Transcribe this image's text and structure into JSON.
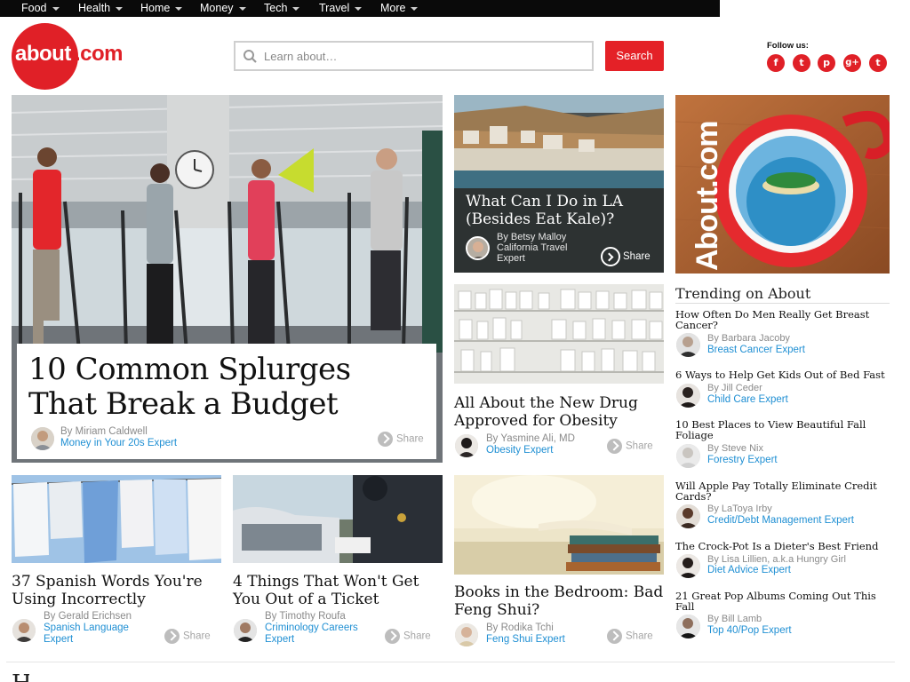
{
  "nav": [
    "Food",
    "Health",
    "Home",
    "Money",
    "Tech",
    "Travel",
    "More"
  ],
  "logo": {
    "about": "about",
    "com": ".com"
  },
  "search": {
    "placeholder": "Learn about…",
    "button": "Search"
  },
  "follow": {
    "label": "Follow us:",
    "icons": [
      "facebook-icon",
      "twitter-icon",
      "pinterest-icon",
      "googleplus-icon",
      "tumblr-icon"
    ]
  },
  "colors": {
    "brand_red": "#e02027",
    "link_blue": "#1f8fd3",
    "nav_bg": "#0a0a0a"
  },
  "hero": {
    "title": "10 Common Splurges That Break a Budget",
    "author": "By Miriam Caldwell",
    "expert": "Money in Your 20s Expert",
    "share": "Share"
  },
  "la": {
    "title": "What Can I Do in LA (Besides Eat Kale)?",
    "author": "By Betsy Malloy",
    "expert": "California Travel Expert",
    "share": "Share"
  },
  "promo": {
    "brand_text": "About.com"
  },
  "drug": {
    "title": "All About the New Drug Approved for Obesity",
    "author": "By Yasmine Ali, MD",
    "expert": "Obesity Expert",
    "share": "Share"
  },
  "spanish": {
    "title": "37 Spanish Words You're Using Incorrectly",
    "author": "By Gerald Erichsen",
    "expert": "Spanish Language Expert",
    "share": "Share"
  },
  "ticket": {
    "title": "4 Things That Won't Get You Out of a Ticket",
    "author": "By Timothy Roufa",
    "expert": "Criminology Careers Expert",
    "share": "Share"
  },
  "books": {
    "title": "Books in the Bedroom: Bad Feng Shui?",
    "author": "By Rodika Tchi",
    "expert": "Feng Shui Expert",
    "share": "Share"
  },
  "trending": {
    "heading": "Trending on About",
    "items": [
      {
        "title": "How Often Do Men Really Get Breast Cancer?",
        "author": "By Barbara Jacoby",
        "expert": "Breast Cancer Expert"
      },
      {
        "title": "6 Ways to Help Get Kids Out of Bed Fast",
        "author": "By Jill Ceder",
        "expert": "Child Care Expert"
      },
      {
        "title": "10 Best Places to View Beautiful Fall Foliage",
        "author": "By Steve Nix",
        "expert": "Forestry Expert"
      },
      {
        "title": "Will Apple Pay Totally Eliminate Credit Cards?",
        "author": "By LaToya Irby",
        "expert": "Credit/Debt Management Expert"
      },
      {
        "title": "The Crock-Pot Is a Dieter's Best Friend",
        "author": "By Lisa Lillien, a.k.a Hungry Girl",
        "expert": "Diet Advice Expert"
      },
      {
        "title": "21 Great Pop Albums Coming Out This Fall",
        "author": "By Bill Lamb",
        "expert": "Top 40/Pop Expert"
      }
    ]
  }
}
